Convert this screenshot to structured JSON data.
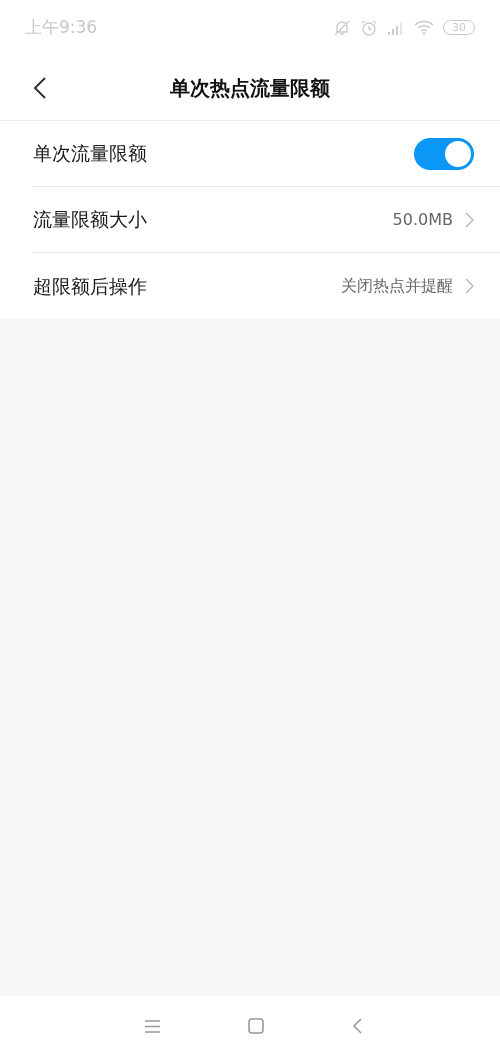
{
  "status_bar": {
    "time": "上午9:36",
    "battery": "30"
  },
  "header": {
    "title": "单次热点流量限额"
  },
  "settings": [
    {
      "kind": "switch",
      "label": "单次流量限额",
      "on": true
    },
    {
      "kind": "link",
      "label": "流量限额大小",
      "value": "50.0MB"
    },
    {
      "kind": "link",
      "label": "超限额后操作",
      "value": "关闭热点并提醒"
    }
  ]
}
